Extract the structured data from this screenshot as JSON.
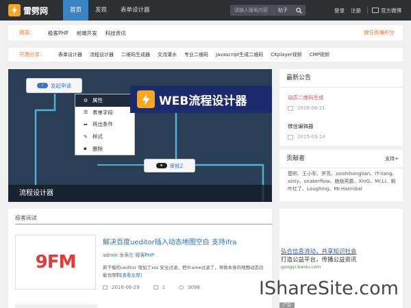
{
  "header": {
    "logo_text": "雷劈网",
    "nav": [
      {
        "label": "首页",
        "active": true
      },
      {
        "label": "发现",
        "active": false
      },
      {
        "label": "表单设计器",
        "active": false
      }
    ],
    "search_placeholder": "请输入搜索内容",
    "search_scope": "帖子",
    "links": [
      "登录",
      "注册"
    ],
    "weibo": "官方微博"
  },
  "channel_bar": {
    "label": "频道：",
    "items": [
      "极客PHP",
      "前端开发",
      "科技资讯"
    ],
    "right_link": "做任务赚积分"
  },
  "tools_bar": {
    "label": "开源分享：",
    "items": [
      "表单设计器",
      "流程设计器",
      "二维码生成器",
      "交流灌水",
      "专业二维码",
      "Javascript生成二维码",
      "CKplayer视频",
      "CMP视频"
    ]
  },
  "hero": {
    "nodes": [
      {
        "label": "发起申请",
        "badge": "✓"
      },
      {
        "label": "审批2",
        "badge": "★"
      }
    ],
    "context_menu": [
      {
        "icon": "gear-icon",
        "label": "属性",
        "selected": true
      },
      {
        "icon": "list-icon",
        "label": "表单字段",
        "selected": false
      },
      {
        "icon": "share-icon",
        "label": "转出条件",
        "selected": false
      },
      {
        "icon": "wrench-icon",
        "label": "样式",
        "selected": false
      },
      {
        "icon": "trash-icon",
        "label": "删除",
        "selected": false
      }
    ],
    "banner_text": "WEB流程设计器",
    "caption": "流程设计器"
  },
  "notice": {
    "title": "最新公告",
    "items": [
      {
        "title": "动态二维码生成",
        "date": "2016-06-21",
        "color": "#d9534f"
      },
      {
        "title": "微信编辑器",
        "date": "2015-03-24",
        "color": "#333333"
      }
    ]
  },
  "contributors": {
    "title": "贡献者",
    "more": "支持+",
    "text": "楚昕、王小军、罗亮、zaishihonglian、IT-liang、ainiy、snakerflow、絶版男爵、XinG、Mr.Li、枫叶红了、Laughing、Mr.Hannibal"
  },
  "blog": {
    "section_title": "极客阅读",
    "thumb_text": "9FM",
    "post": {
      "title": "解决百度ueditor插入动态地图空白 支持ifra",
      "author": "admin",
      "meta_mid": "发表在",
      "category": "极客PHP",
      "excerpt": "新下载的ueditor 增加了xss 安全过滤，把iframe过滤了，导致本身的地图动态功能也限制",
      "read_more": "[查看全部]",
      "date": "2016-06-29",
      "comments": "1",
      "views": "3098"
    }
  },
  "ad": {
    "line1": "弘合信息流动，共享知识社会",
    "line2": "打造公益平台，传播公益资讯",
    "line3": "gongyi.baidu.com",
    "tag": "广告"
  },
  "watermark": "IShareSite.com"
}
